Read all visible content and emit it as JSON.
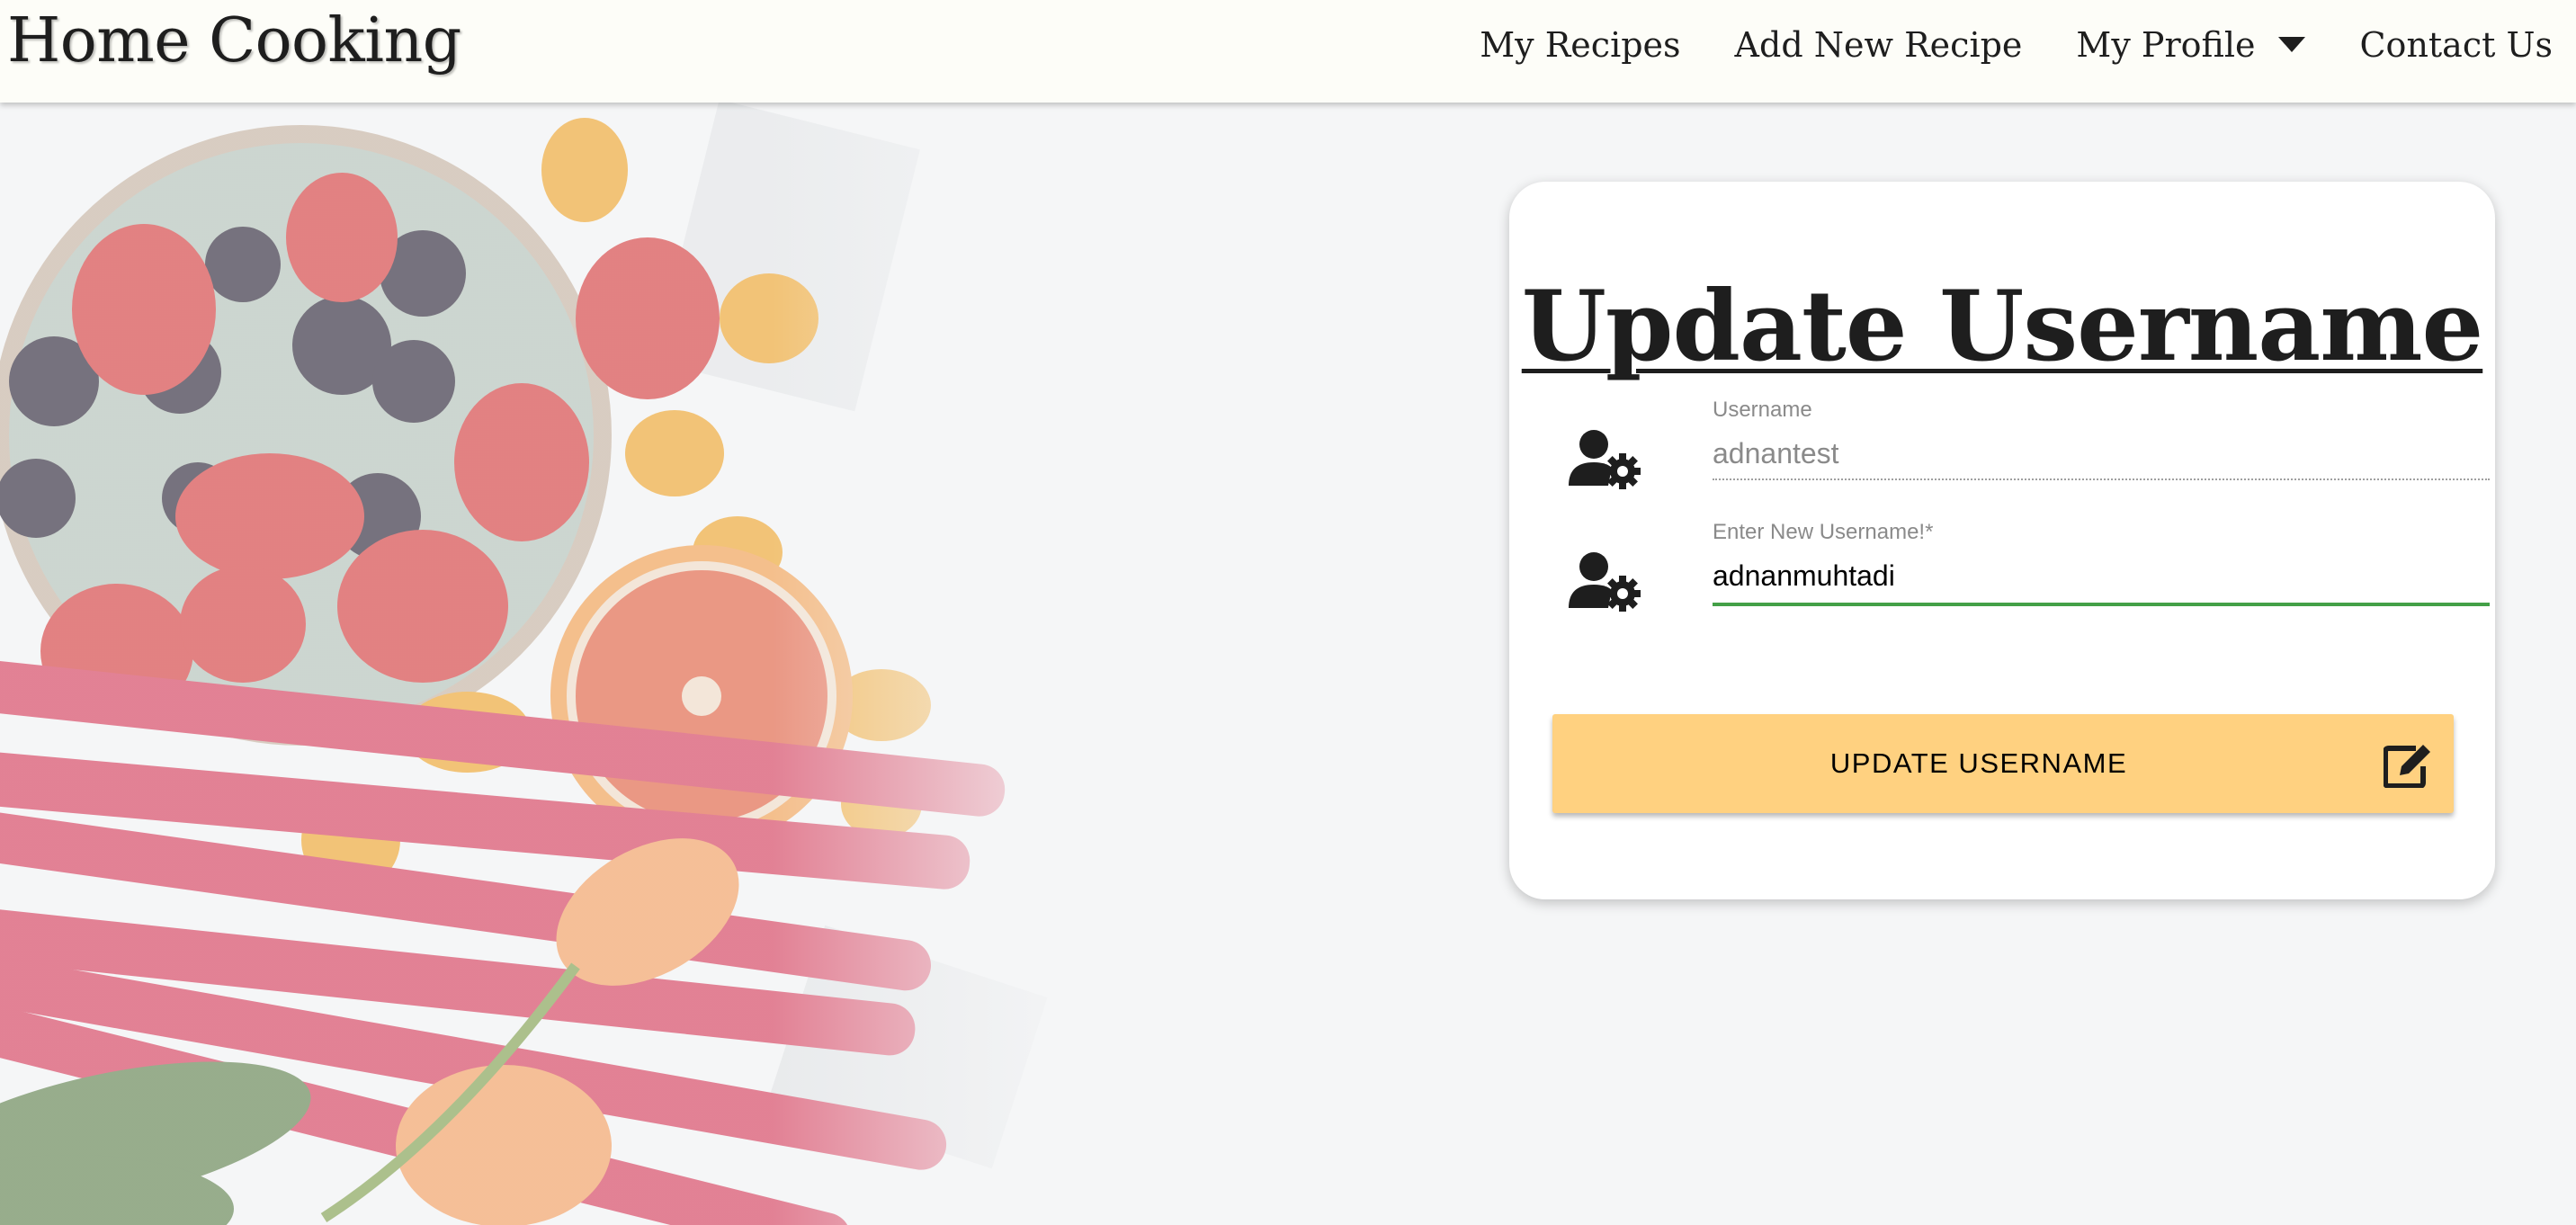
{
  "navbar": {
    "brand": "Home Cooking",
    "links": [
      {
        "label": "My Recipes"
      },
      {
        "label": "Add New Recipe"
      },
      {
        "label": "My Profile",
        "has_dropdown": true,
        "icon": "caret-down-icon"
      },
      {
        "label": "Contact Us"
      }
    ]
  },
  "form": {
    "title": "Update Username",
    "current_username": {
      "label": "Username",
      "value": "adnantest",
      "icon": "user-cog-icon"
    },
    "new_username": {
      "label": "Enter New Username!*",
      "value": "adnanmuhtadi",
      "icon": "user-cog-icon"
    },
    "submit": {
      "label": "UPDATE USERNAME",
      "icon": "edit-icon"
    }
  },
  "colors": {
    "navbar_bg": "#fdfdf8",
    "button_bg": "#ffd180",
    "active_underline": "#43a047",
    "text": "#1e1e1e"
  }
}
